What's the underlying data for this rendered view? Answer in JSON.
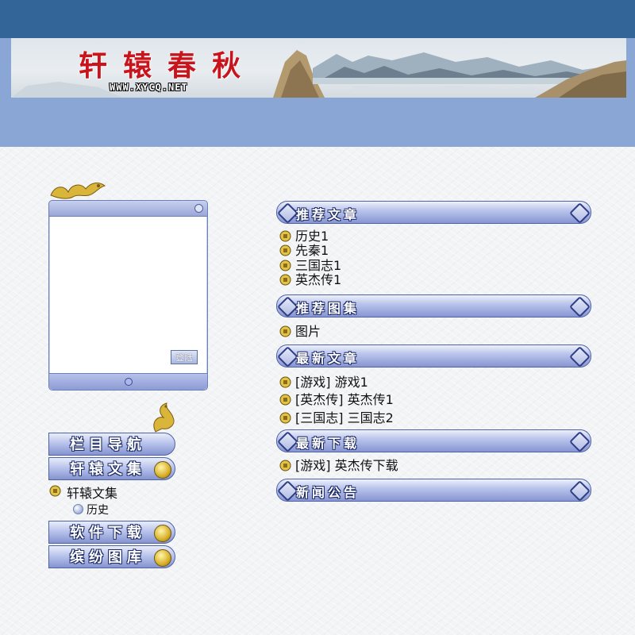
{
  "banner": {
    "title": "轩辕春秋",
    "url": "WWW.XYCQ.NET"
  },
  "login": {
    "button_label": "登陆"
  },
  "nav": {
    "buttons": [
      {
        "label": "栏目导航"
      },
      {
        "label": "轩辕文集"
      },
      {
        "label": "软件下载"
      },
      {
        "label": "缤纷图库"
      }
    ],
    "category": "轩辕文集",
    "sub_item": "历史"
  },
  "sections": [
    {
      "title": "推荐文章",
      "items": [
        "历史1",
        "先秦1",
        "三国志1",
        "英杰传1"
      ]
    },
    {
      "title": "推荐图集",
      "items": [
        "图片"
      ]
    },
    {
      "title": "最新文章",
      "items": [
        "[游戏] 游戏1",
        "[英杰传] 英杰传1",
        "[三国志] 三国志2"
      ]
    },
    {
      "title": "最新下载",
      "items": [
        "[游戏] 英杰传下载"
      ]
    },
    {
      "title": "新闻公告",
      "items": []
    }
  ],
  "colors": {
    "top_band": "#346599",
    "blue_band": "#8aa6d4",
    "title_red": "#c8141c",
    "header_border": "#5062a4"
  },
  "icons": [
    "coin-bullet-icon",
    "dragon-ornament-icon",
    "knot-ornament-icon"
  ]
}
